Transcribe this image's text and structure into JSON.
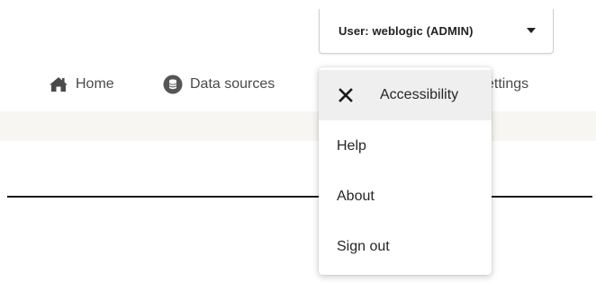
{
  "user_menu": {
    "label": "User: weblogic (ADMIN)",
    "items": [
      {
        "label": "Accessibility",
        "icon": "close-icon"
      },
      {
        "label": "Help"
      },
      {
        "label": "About"
      },
      {
        "label": "Sign out"
      }
    ]
  },
  "nav": {
    "home": {
      "label": "Home",
      "icon": "home-icon"
    },
    "data_sources": {
      "label": "Data sources",
      "icon": "database-icon"
    },
    "settings": {
      "label": "ettings"
    }
  }
}
